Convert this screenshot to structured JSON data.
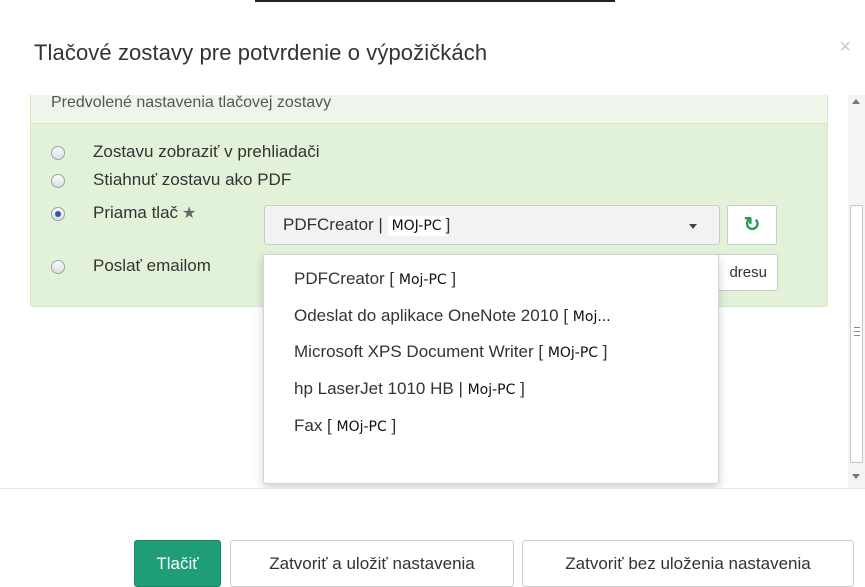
{
  "modal": {
    "title": "Tlačové zostavy pre potvrdenie o výpožičkách",
    "close": "×"
  },
  "panel": {
    "heading": "Predvolené nastavenia tlačovej zostavy",
    "options": [
      {
        "label": "Zostavu zobraziť v prehliadači",
        "checked": false
      },
      {
        "label": "Stiahnuť zostavu ako PDF",
        "checked": false
      },
      {
        "label": "Priama tlač",
        "checked": true
      },
      {
        "label": "Poslať emailom",
        "checked": false
      }
    ],
    "star_icon": "★",
    "printer_select": {
      "value_prefix": "PDFCreator |",
      "value_pc": "MOJ-PC",
      "value_suffix": "]"
    },
    "refresh_icon": "↻",
    "email_button_label": "dresu"
  },
  "dropdown": {
    "items": [
      {
        "prefix": "PDFCreator [ ",
        "pc": "Moj-PC",
        "suffix": " ]"
      },
      {
        "prefix": "Odeslat do aplikace OneNote 2010 [ ",
        "pc": "Moj...",
        "suffix": ""
      },
      {
        "prefix": "Microsoft XPS Document Writer [ ",
        "pc": "MOj-PC",
        "suffix": " ]"
      },
      {
        "prefix": "hp LaserJet 1010 HB | ",
        "pc": "Moj-PC",
        "suffix": " ]"
      },
      {
        "prefix": "Fax [ ",
        "pc": "MOj-PC",
        "suffix": " ]"
      }
    ]
  },
  "footer": {
    "print_label": "Tlačiť",
    "close_save_label": "Zatvoriť a uložiť nastavenia",
    "close_nosave_label": "Zatvoriť bez uloženia nastavenia"
  },
  "colors": {
    "primary": "#1f9d76",
    "panel_bg": "#e2f2d9",
    "refresh": "#2a9a55"
  }
}
